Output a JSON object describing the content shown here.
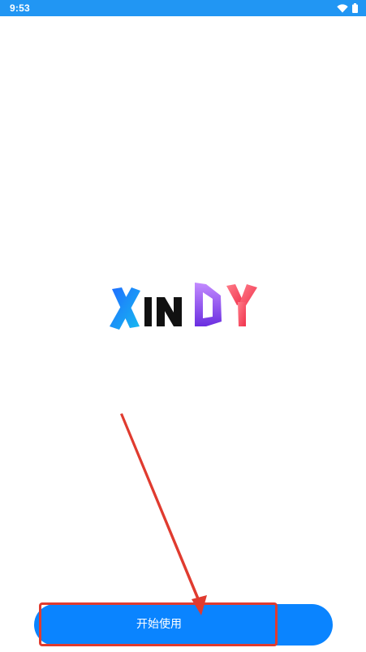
{
  "status_bar": {
    "time": "9:53",
    "icons": [
      "wifi-icon",
      "battery-icon"
    ],
    "background": "#2196f3"
  },
  "logo": {
    "text": "XINDY",
    "letters": [
      "X",
      "I",
      "N",
      "D",
      "Y"
    ]
  },
  "start_button": {
    "label": "开始使用",
    "color": "#0a84ff"
  },
  "annotation": {
    "color": "#e03b2f"
  }
}
